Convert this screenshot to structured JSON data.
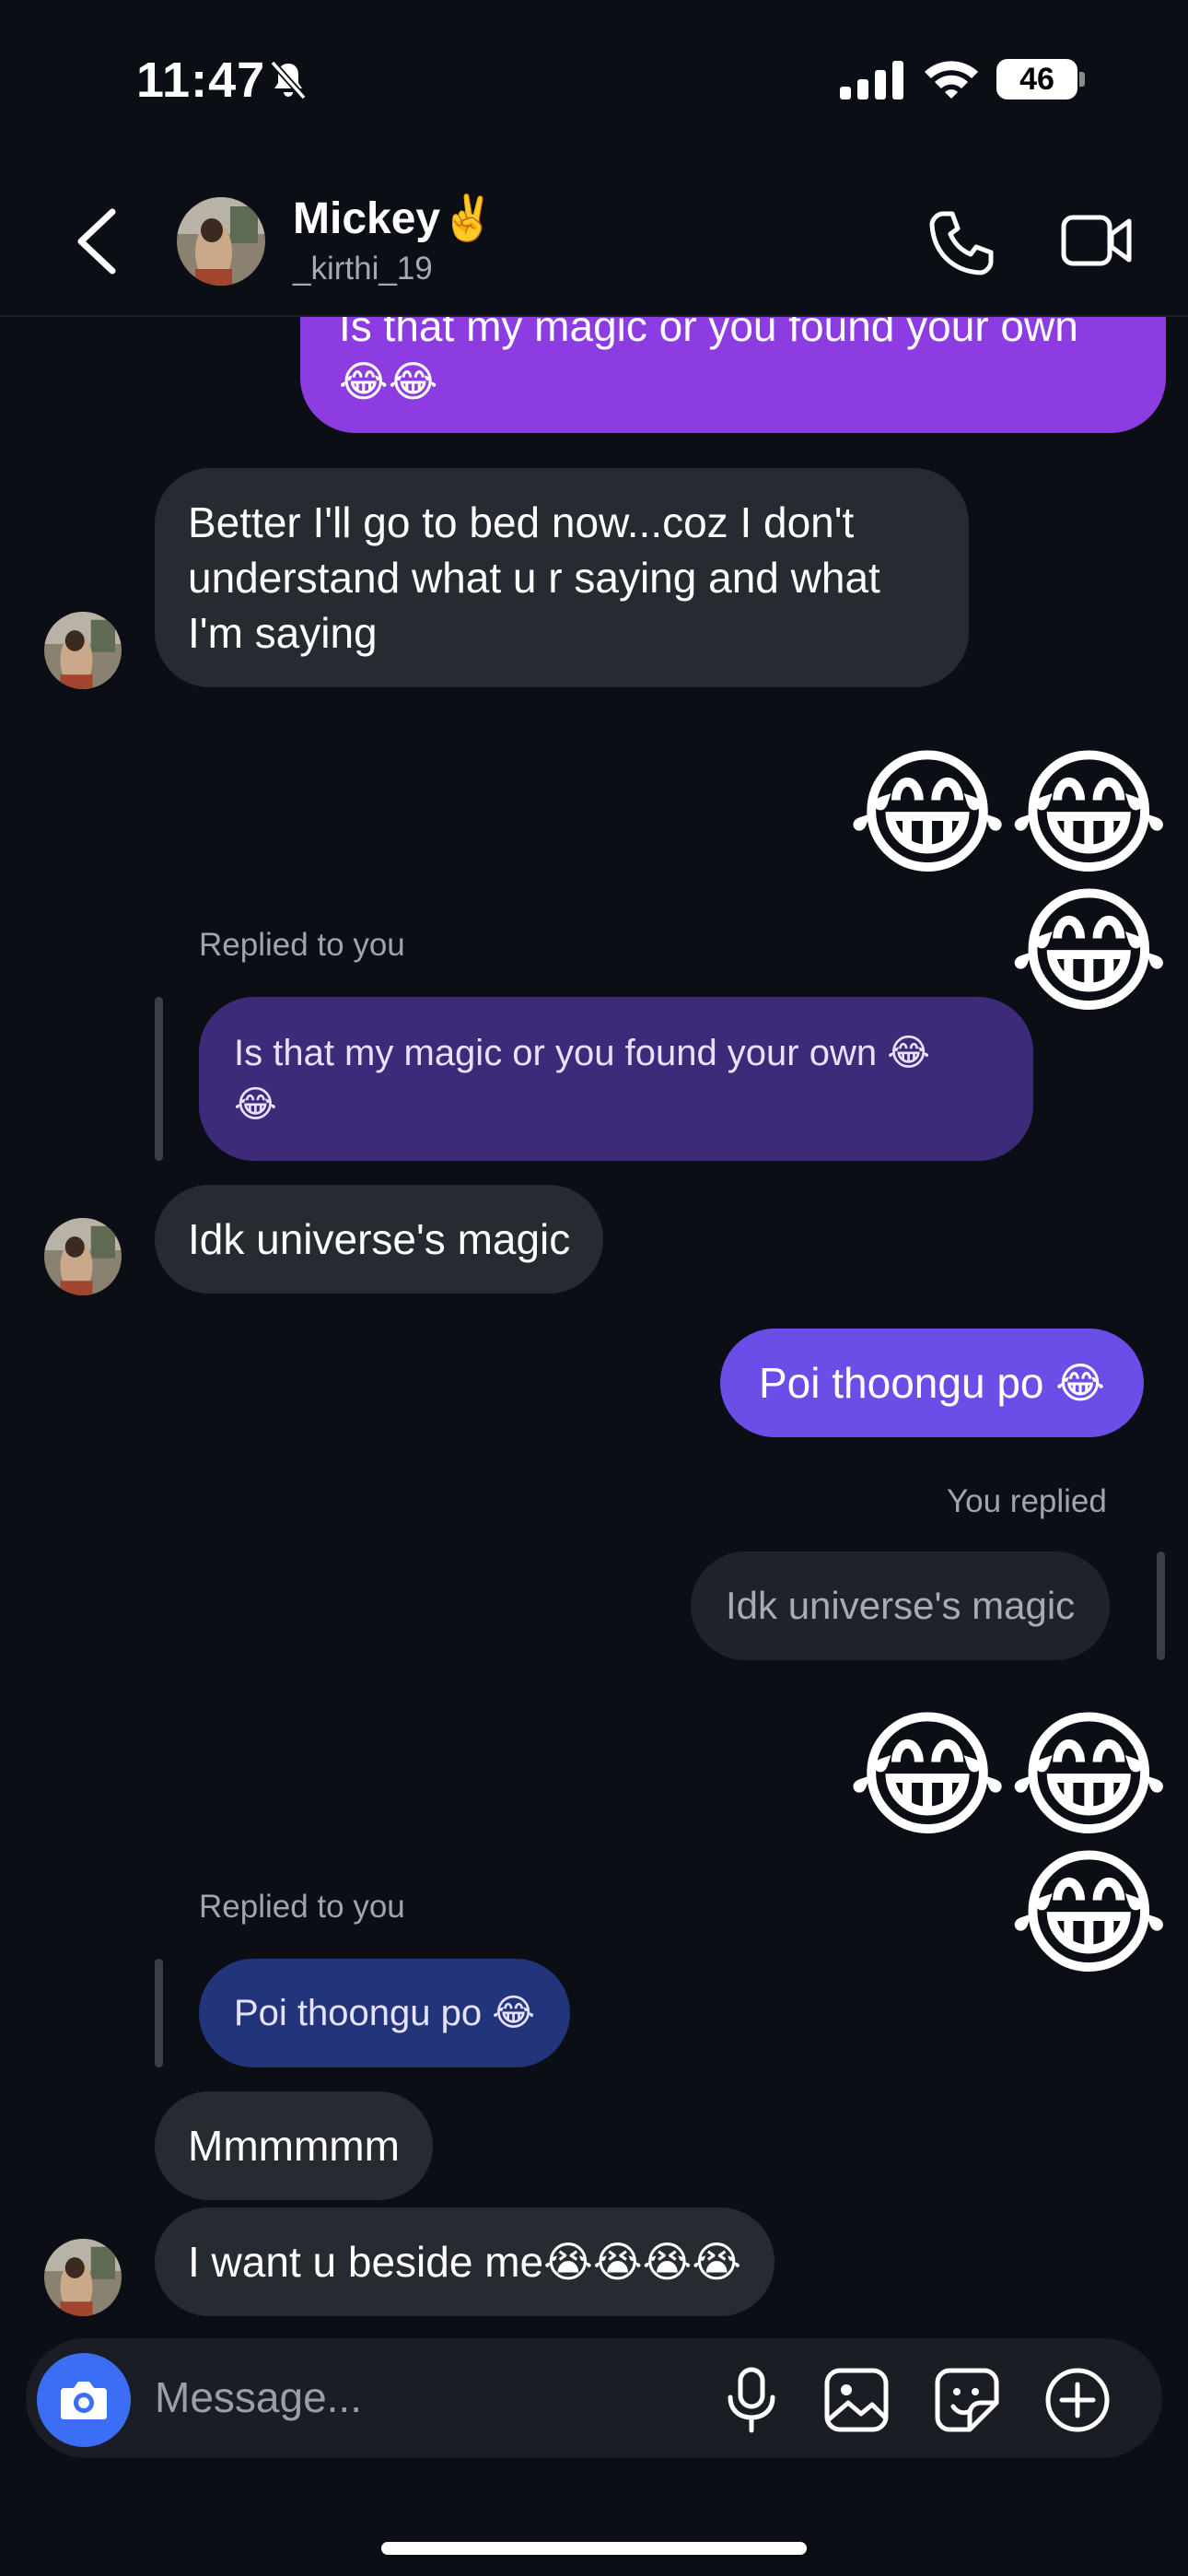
{
  "status_bar": {
    "time": "11:47",
    "battery": "46"
  },
  "header": {
    "name": "Mickey",
    "name_emoji": "✌️",
    "handle": "_kirthi_19"
  },
  "messages": {
    "m1_partial": "Is that my magic or you found your own",
    "m1_emoji": "😂😂",
    "m2": [
      "Better I'll go to bed now...coz I don't",
      "understand what u r saying and what",
      "I'm saying"
    ],
    "m3_emoji": "😂😂😂",
    "reply1_label": "Replied to you",
    "reply1_quote": [
      "Is that my magic or you found your own 😂",
      "😂"
    ],
    "m4": "Idk universe's magic",
    "m5": "Poi thoongu po 😂",
    "reply2_label": "You replied",
    "reply2_quote": "Idk universe's magic",
    "m6_emoji": "😂😂😂",
    "reply3_label": "Replied to you",
    "reply3_quote": "Poi thoongu po 😂",
    "m7": "Mmmmmm",
    "m8": "I want u beside me😭😭😭😭"
  },
  "composer": {
    "placeholder": "Message..."
  },
  "colors": {
    "background": "#0b0e15",
    "incoming": "#262a31",
    "outgoing": "#6b4ee8",
    "camera": "#3b6ef5"
  },
  "icons": [
    "bell-slash-icon",
    "signal-icon",
    "wifi-icon",
    "back-chevron-icon",
    "phone-icon",
    "video-icon",
    "camera-icon",
    "mic-icon",
    "gallery-icon",
    "sticker-icon",
    "plus-icon"
  ]
}
